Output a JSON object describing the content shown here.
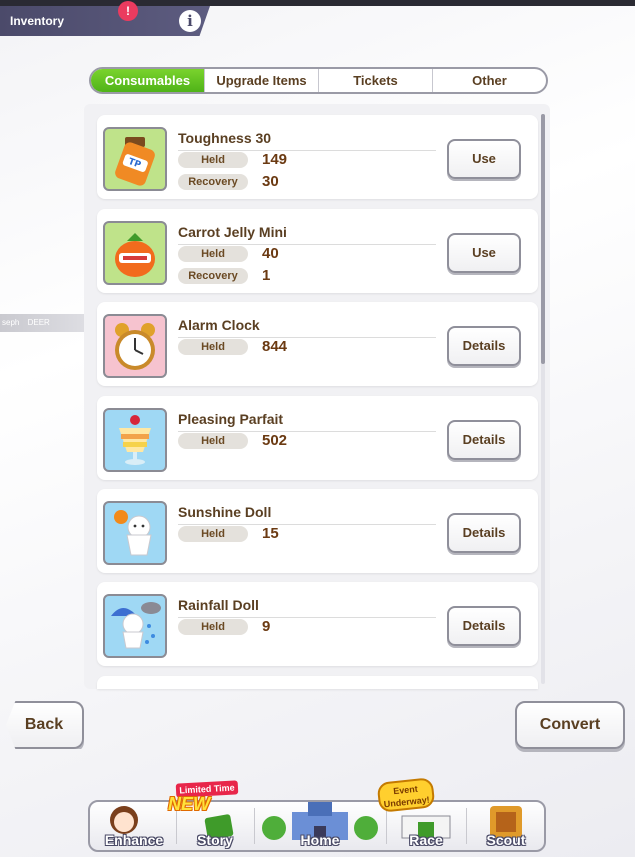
{
  "header": {
    "title": "Inventory",
    "info_glyph": "i"
  },
  "side_tag": {
    "left": "seph",
    "middle": "DEER"
  },
  "tabs": [
    {
      "label": "Consumables",
      "active": true
    },
    {
      "label": "Upgrade Items",
      "active": false
    },
    {
      "label": "Tickets",
      "active": false
    },
    {
      "label": "Other",
      "active": false
    }
  ],
  "items": [
    {
      "name": "Toughness 30",
      "icon": "tp-bottle-icon",
      "held_label": "Held",
      "held": "149",
      "recovery_label": "Recovery",
      "recovery": "30",
      "button": "Use"
    },
    {
      "name": "Carrot Jelly Mini",
      "icon": "carrot-jelly-icon",
      "held_label": "Held",
      "held": "40",
      "recovery_label": "Recovery",
      "recovery": "1",
      "button": "Use"
    },
    {
      "name": "Alarm Clock",
      "icon": "alarm-clock-icon",
      "held_label": "Held",
      "held": "844",
      "button": "Details"
    },
    {
      "name": "Pleasing Parfait",
      "icon": "parfait-icon",
      "held_label": "Held",
      "held": "502",
      "button": "Details"
    },
    {
      "name": "Sunshine Doll",
      "icon": "sunshine-doll-icon",
      "held_label": "Held",
      "held": "15",
      "button": "Details"
    },
    {
      "name": "Rainfall Doll",
      "icon": "rainfall-doll-icon",
      "held_label": "Held",
      "held": "9",
      "button": "Details"
    }
  ],
  "bottom": {
    "back": "Back",
    "convert": "Convert"
  },
  "nav": [
    {
      "label": "Enhance",
      "icon": "enhance-icon"
    },
    {
      "label": "Story",
      "icon": "story-icon"
    },
    {
      "label": "Home",
      "icon": "home-icon"
    },
    {
      "label": "Race",
      "icon": "race-icon"
    },
    {
      "label": "Scout",
      "icon": "scout-icon"
    }
  ],
  "badges": {
    "limited": "Limited Time",
    "new": "NEW",
    "event_line1": "Event",
    "event_line2": "Underway!"
  },
  "colors": {
    "tab_active": "#5cbf1f",
    "header_bg": "#4b4a6a",
    "text_brown": "#5a3f22"
  }
}
